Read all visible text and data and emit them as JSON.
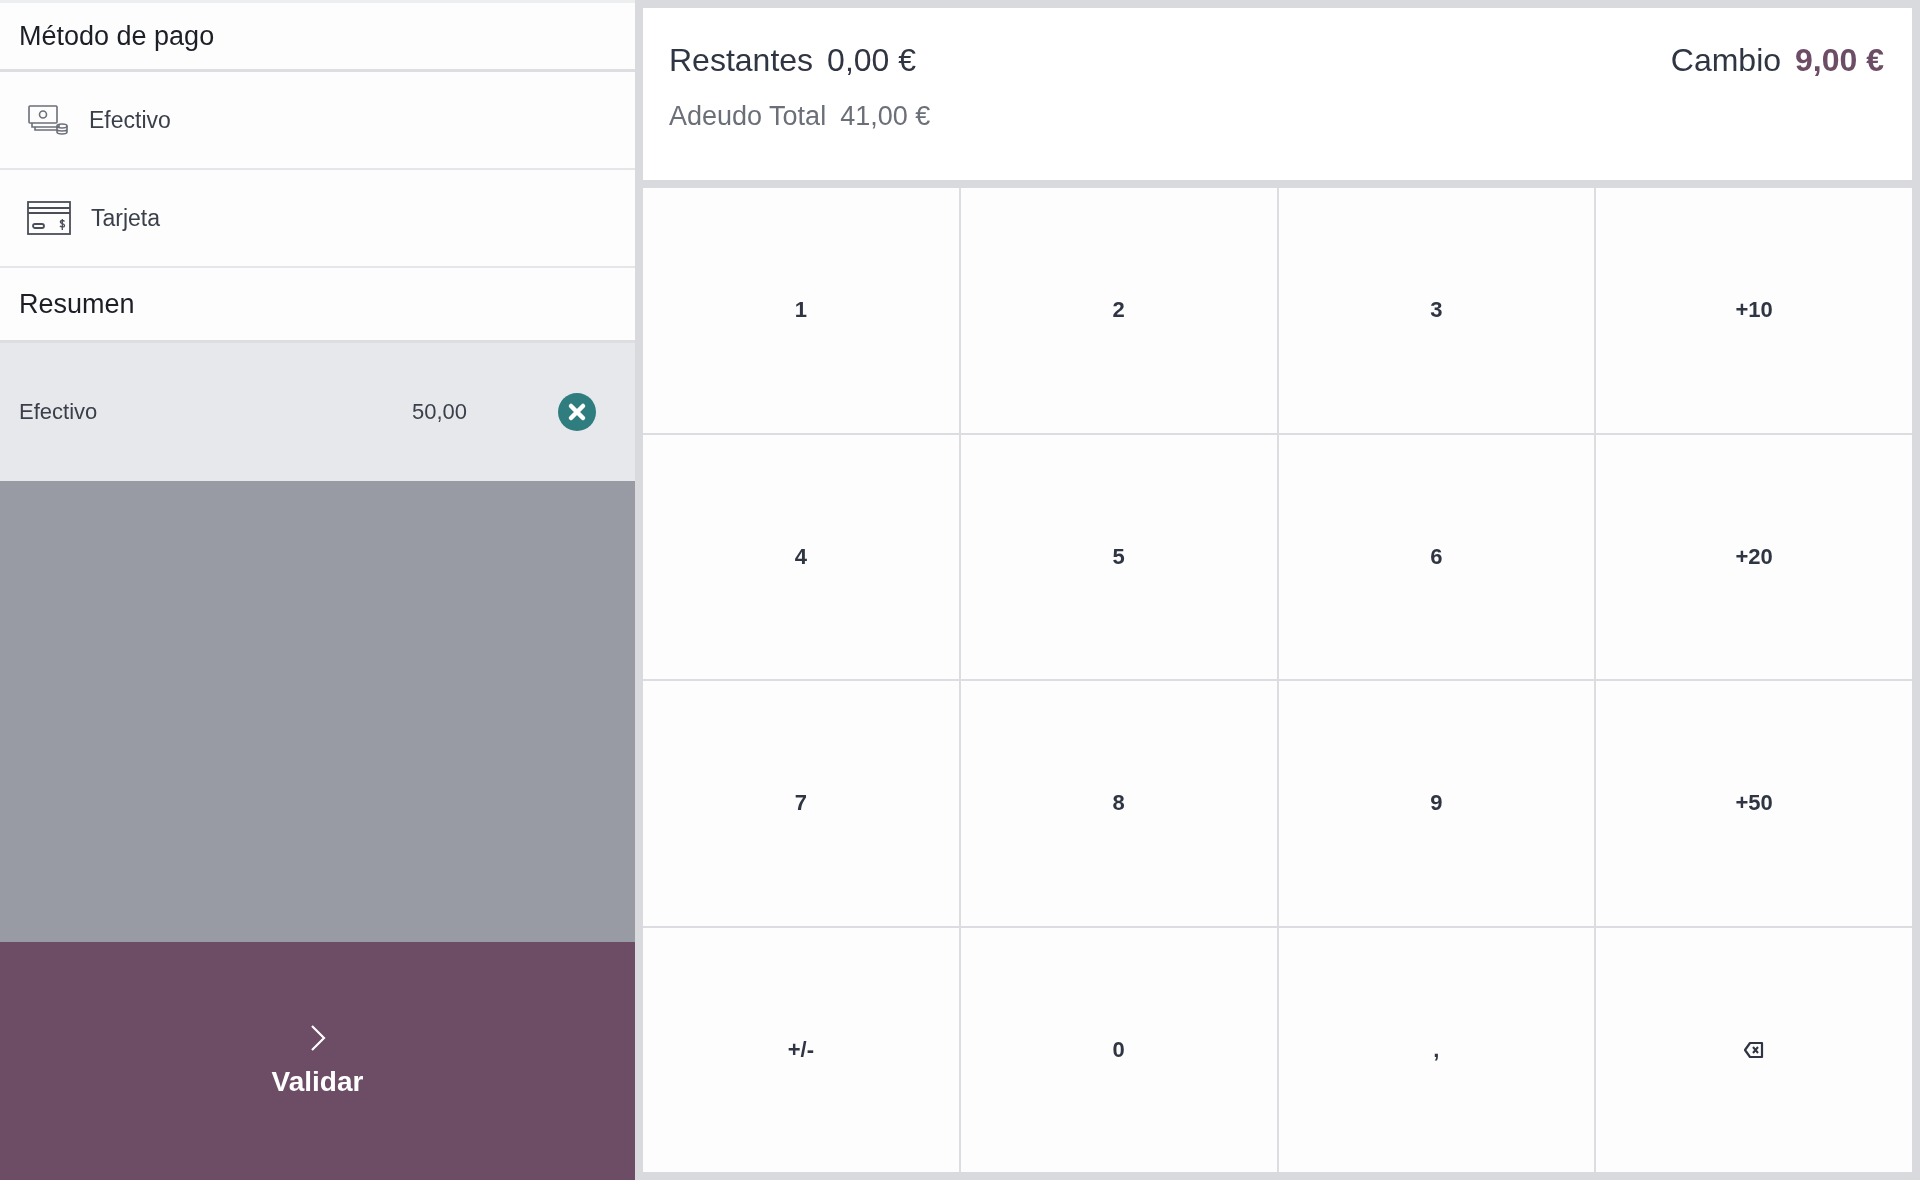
{
  "payment_methods": {
    "title": "Método de pago",
    "items": [
      {
        "label": "Efectivo",
        "kind": "cash"
      },
      {
        "label": "Tarjeta",
        "kind": "card"
      }
    ]
  },
  "summary": {
    "title": "Resumen",
    "lines": [
      {
        "method": "Efectivo",
        "amount": "50,00",
        "selected": true
      }
    ]
  },
  "validate_button": {
    "label": "Validar"
  },
  "totals": {
    "remaining_label": "Restantes",
    "remaining": "0,00 €",
    "change_label": "Cambio",
    "change": "9,00 €",
    "total_due_label": "Adeudo Total",
    "total_due": "41,00 €"
  },
  "keypad": [
    {
      "kind": "text",
      "label": "1"
    },
    {
      "kind": "text",
      "label": "2"
    },
    {
      "kind": "text",
      "label": "3"
    },
    {
      "kind": "text",
      "label": "+10"
    },
    {
      "kind": "text",
      "label": "4"
    },
    {
      "kind": "text",
      "label": "5"
    },
    {
      "kind": "text",
      "label": "6"
    },
    {
      "kind": "text",
      "label": "+20"
    },
    {
      "kind": "text",
      "label": "7"
    },
    {
      "kind": "text",
      "label": "8"
    },
    {
      "kind": "text",
      "label": "9"
    },
    {
      "kind": "text",
      "label": "+50"
    },
    {
      "kind": "text",
      "label": "+/-"
    },
    {
      "kind": "text",
      "label": "0"
    },
    {
      "kind": "text",
      "label": ","
    },
    {
      "kind": "backspace"
    }
  ]
}
